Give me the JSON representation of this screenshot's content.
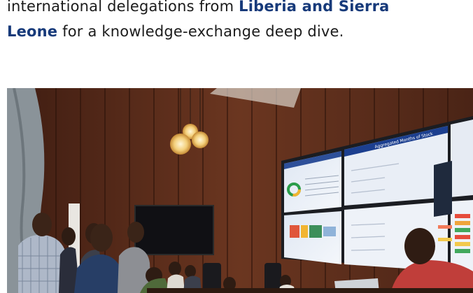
{
  "article": {
    "line1_prefix": "international delegations from ",
    "highlight": "Liberia and Sierra",
    "line2_highlight": "Leone",
    "line2_suffix": " for a knowledge-exchange deep dive."
  },
  "photo": {
    "screen_title": "Aggregated Months of Stock",
    "colors": {
      "wall_wood": "#5a2e1c",
      "screen_glow": "#e8eef7",
      "accent_blue": "#1c3f8f"
    }
  }
}
